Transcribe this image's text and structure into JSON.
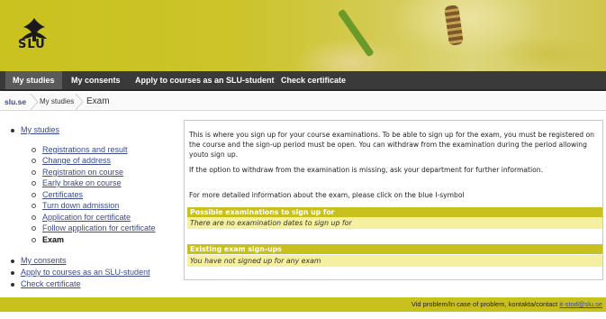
{
  "logo": {
    "text": "SLU",
    "icon": "slu-tree-logo"
  },
  "nav": {
    "items": [
      {
        "label": "My studies"
      },
      {
        "label": "My consents"
      },
      {
        "label": "Apply to courses as an SLU-student"
      },
      {
        "label": "Check certificate"
      }
    ]
  },
  "breadcrumb": {
    "items": [
      {
        "label": "slu.se"
      },
      {
        "label": "My studies"
      },
      {
        "label": "Exam"
      }
    ]
  },
  "sidebar": {
    "top": "My studies",
    "sub": [
      "Registrations and result",
      "Change of address",
      "Registration on course",
      "Early brake on course",
      "Certificates",
      "Turn down admission",
      "Application for certificate",
      "Follow application for certificate",
      "Exam"
    ],
    "bottom": [
      "My consents",
      "Apply to courses as an SLU-student",
      "Check certificate"
    ]
  },
  "content": {
    "intro": "This is where you sign up for your course examinations. To be able to sign up for the exam, you must be registered on the course and the sign-up period must be open. You can withdraw from the examination during the period allowing youto sign up.",
    "withdraw_note": "If the option to withdraw from the examination is missing, ask your department for further information.",
    "info_note": "For more detailed information about the exam, please click on the blue I-symbol",
    "possible": {
      "title": "Possible examinations to sign up for",
      "empty": "There are no examination dates to sign up for"
    },
    "existing": {
      "title": "Existing exam sign-ups",
      "empty": "You have not signed up for any exam"
    }
  },
  "footer": {
    "text": "Vid problem/In case of problem, kontakta/contact",
    "email": "it-stod@slu.se"
  }
}
